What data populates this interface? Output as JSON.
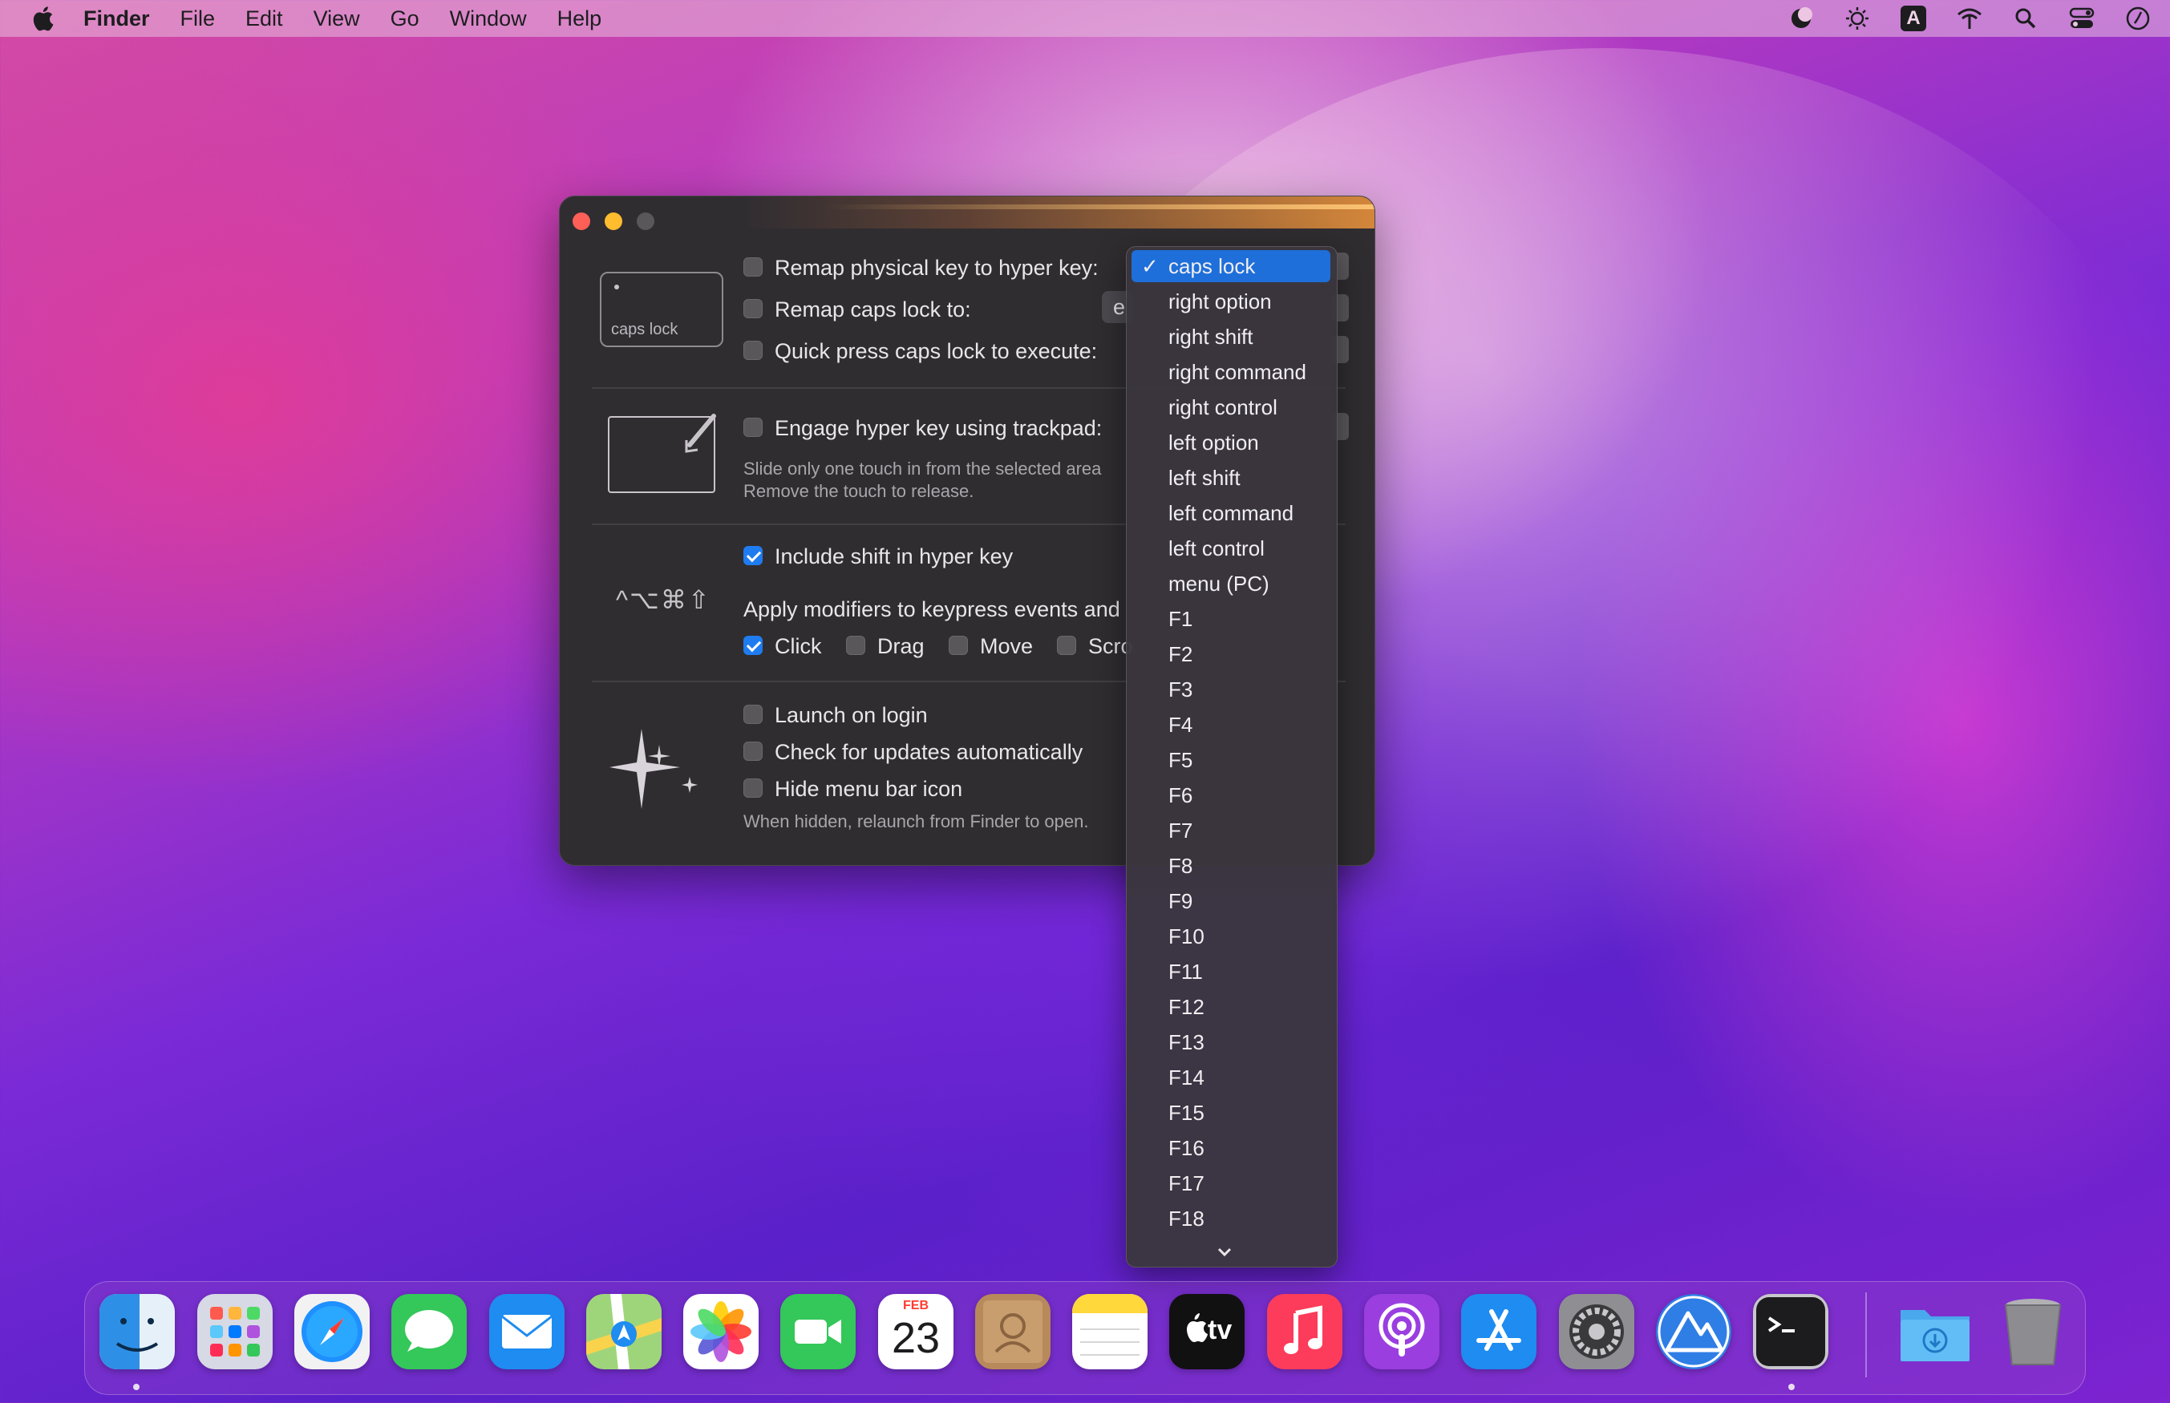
{
  "menubar": {
    "app_name": "Finder",
    "items": [
      "File",
      "Edit",
      "View",
      "Go",
      "Window",
      "Help"
    ],
    "status_icons": [
      "night-shift-icon",
      "brightness-icon",
      "input-source-icon",
      "wifi-icon",
      "search-icon",
      "control-center-icon",
      "clock-icon"
    ],
    "input_source_letter": "A"
  },
  "window": {
    "keycap_label": "caps lock",
    "remap_physical_label": "Remap physical key to hyper key:",
    "remap_caps_label": "Remap caps lock to:",
    "remap_caps_value": "e",
    "quick_press_label": "Quick press caps lock to execute:",
    "trackpad_label": "Engage hyper key using trackpad:",
    "trackpad_desc_1": "Slide only one touch in from the selected area",
    "trackpad_desc_2": "Remove the touch to release.",
    "modifier_symbols": "^⌥⌘⇧",
    "include_shift_label": "Include shift in hyper key",
    "apply_modifiers_label": "Apply modifiers to keypress events and",
    "mouse_options": [
      "Click",
      "Drag",
      "Move",
      "Scro"
    ],
    "launch_login_label": "Launch on login",
    "check_updates_label": "Check for updates automatically",
    "hide_icon_label": "Hide menu bar icon",
    "hidden_desc": "When hidden, relaunch from Finder to open.",
    "checkbox_state": {
      "remap_physical": false,
      "remap_caps": false,
      "quick_press": false,
      "trackpad": false,
      "include_shift": true,
      "click": true,
      "drag": false,
      "move": false,
      "scroll": false,
      "launch_login": false,
      "check_updates": false,
      "hide_icon": false
    }
  },
  "dropdown": {
    "selected": "caps lock",
    "check_mark": "✓",
    "options": [
      "caps lock",
      "right option",
      "right shift",
      "right command",
      "right control",
      "left option",
      "left shift",
      "left command",
      "left control",
      "menu (PC)",
      "F1",
      "F2",
      "F3",
      "F4",
      "F5",
      "F6",
      "F7",
      "F8",
      "F9",
      "F10",
      "F11",
      "F12",
      "F13",
      "F14",
      "F15",
      "F16",
      "F17",
      "F18"
    ]
  },
  "dock": {
    "calendar_month": "FEB",
    "calendar_day": "23",
    "tv_label": "tv",
    "apps": [
      "finder",
      "launchpad",
      "safari",
      "messages",
      "mail",
      "maps",
      "photos",
      "facetime",
      "calendar",
      "contacts",
      "notes",
      "apple-tv",
      "music",
      "podcasts",
      "app-store",
      "system-preferences",
      "hyperkey",
      "terminal",
      "downloads-folder",
      "trash"
    ]
  }
}
